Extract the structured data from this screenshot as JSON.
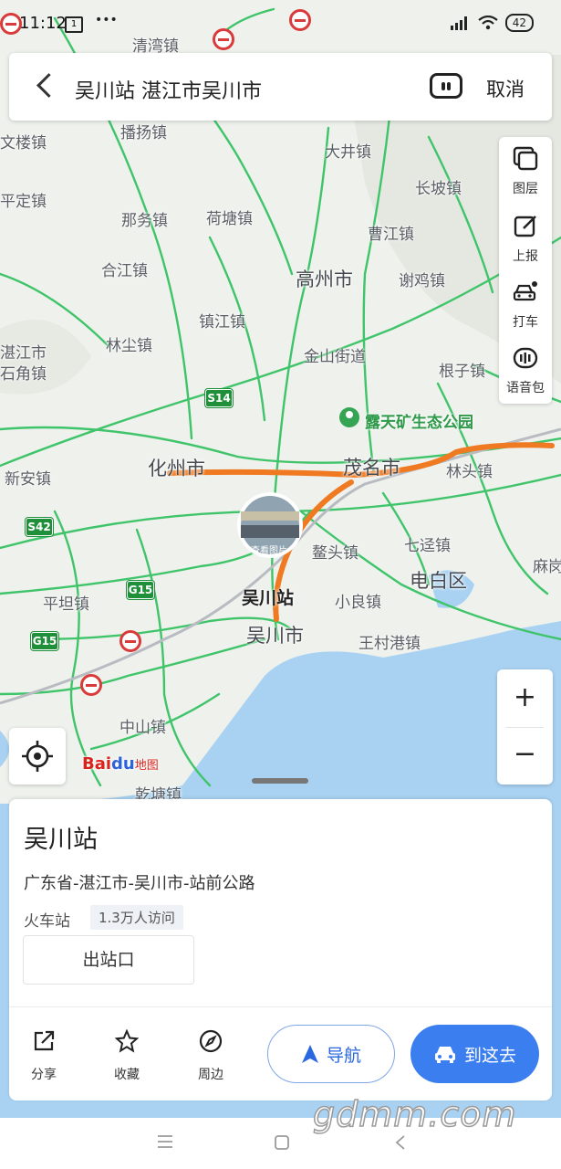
{
  "status_bar": {
    "time": "11:12",
    "notification": "1",
    "dots": "•••",
    "battery": "42"
  },
  "search": {
    "query": "吴川站 湛江市吴川市",
    "cancel_label": "取消"
  },
  "map": {
    "towns": {
      "qingwan": "清湾镇",
      "boyang": "播扬镇",
      "wenlou": "文楼镇",
      "pingding": "平定镇",
      "nawu": "那务镇",
      "hetang": "荷塘镇",
      "hejiang": "合江镇",
      "zhenjiang": "镇江镇",
      "linchen": "林尘镇",
      "zhanjiang_shijiao": "湛江市\n石角镇",
      "xinan": "新安镇",
      "dajing": "大井镇",
      "changpo": "长坡镇",
      "caojiang": "曹江镇",
      "xieji": "谢鸡镇",
      "jinshan": "金山街道",
      "genzi": "根子镇",
      "lintou": "林头镇",
      "qidian": "七迳镇",
      "aotou": "鳌头镇",
      "xiaoliang": "小良镇",
      "wangcun": "王村港镇",
      "pingtan": "平坦镇",
      "zhongshan": "中山镇",
      "qiantang": "乾塘镇",
      "mahuo": "麻岗"
    },
    "cities": {
      "gaozhou": "高州市",
      "huazhou": "化州市",
      "maoming": "茂名市",
      "dianbai": "电白区",
      "wuchuan": "吴川市"
    },
    "station_label": "吴川站",
    "poi_park": "露天矿生态公园",
    "photo_label": "查看图片",
    "shields": {
      "s14": "S14",
      "s42": "S42",
      "g15a": "G15",
      "g15b": "G15"
    },
    "logo": {
      "bai": "Bai",
      "du": "du",
      "ditu": "地图"
    },
    "colors": {
      "road": "#3fc46a",
      "annotation": "#f07a22",
      "water": "#a9d2f2",
      "accent": "#3b7ef0"
    }
  },
  "tools": [
    {
      "label": "图层",
      "icon": "layers-icon"
    },
    {
      "label": "上报",
      "icon": "report-icon"
    },
    {
      "label": "打车",
      "icon": "taxi-icon"
    },
    {
      "label": "语音包",
      "icon": "voice-pack-icon"
    }
  ],
  "zoom": {
    "in": "+",
    "out": "−"
  },
  "place": {
    "name": "吴川站",
    "address": "广东省-湛江市-吴川市-站前公路",
    "category": "火车站",
    "visits": "1.3万人访问",
    "exit_label": "出站口"
  },
  "actions": [
    {
      "label": "分享",
      "icon": "share-icon"
    },
    {
      "label": "收藏",
      "icon": "star-icon"
    },
    {
      "label": "周边",
      "icon": "compass-icon"
    }
  ],
  "buttons": {
    "navigate": "导航",
    "go_here": "到这去"
  },
  "watermark": "gdmm.com"
}
